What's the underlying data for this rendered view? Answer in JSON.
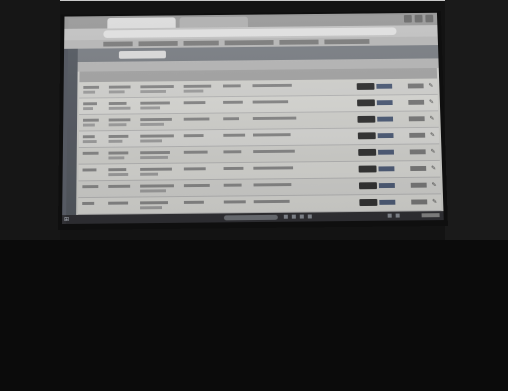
{
  "colors": {
    "room": "#131313",
    "screen": "#d8d8d4",
    "app_toolbar": "#7b7f86",
    "action_button": "#2c2c2c",
    "taskbar": "#2a2a2e"
  },
  "icons": {
    "start": "windows-icon",
    "row_actions": "edit-delete-icons"
  },
  "table": {
    "row_count": 8
  }
}
